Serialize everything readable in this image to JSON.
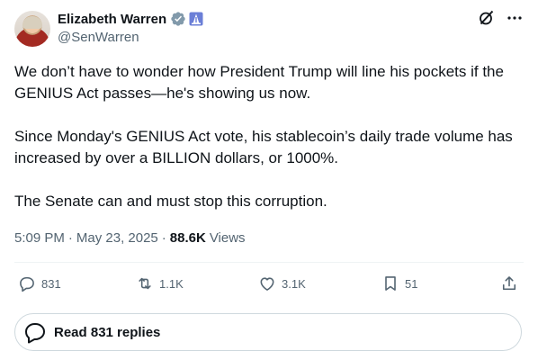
{
  "author": {
    "name": "Elizabeth Warren",
    "handle": "@SenWarren"
  },
  "tweet": {
    "text": "We don’t have to wonder how President Trump will line his pockets if the GENIUS Act passes—he's showing us now.\n\nSince Monday's GENIUS Act vote, his stablecoin’s daily trade volume has increased by over a BILLION dollars, or 1000%.\n\nThe Senate can and must stop this corruption.",
    "time": "5:09 PM",
    "date": "May 23, 2025",
    "views_count": "88.6K",
    "views_label": "Views"
  },
  "actions": {
    "replies": "831",
    "reposts": "1.1K",
    "likes": "3.1K",
    "bookmarks": "51"
  },
  "read_replies_label": "Read 831 replies",
  "colors": {
    "text": "#0f1419",
    "secondary": "#536471",
    "verified": "#829aab",
    "border": "#cfd9de"
  },
  "icons": [
    "verified-badge-icon",
    "government-label-icon",
    "grok-icon",
    "more-icon",
    "reply-icon",
    "repost-icon",
    "like-icon",
    "bookmark-icon",
    "share-icon",
    "replies-bubble-icon"
  ]
}
